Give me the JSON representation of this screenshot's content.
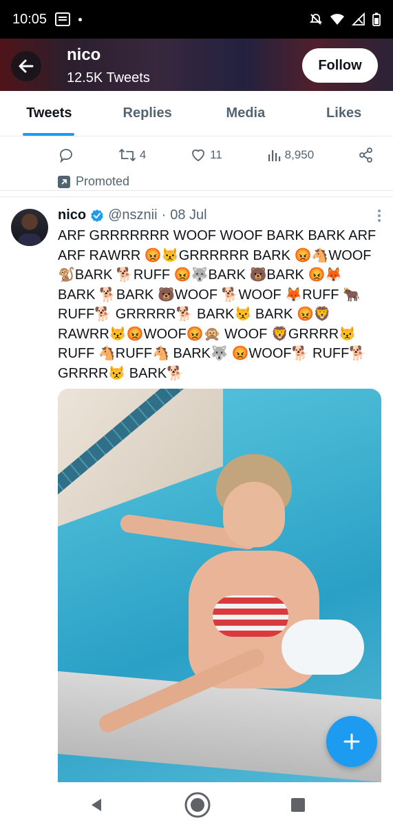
{
  "status_bar": {
    "time": "10:05"
  },
  "header": {
    "name": "nico",
    "tweet_count": "12.5K Tweets",
    "follow_label": "Follow"
  },
  "tabs": [
    {
      "label": "Tweets",
      "active": true
    },
    {
      "label": "Replies",
      "active": false
    },
    {
      "label": "Media",
      "active": false
    },
    {
      "label": "Likes",
      "active": false
    }
  ],
  "promoted_tweet": {
    "retweets": "4",
    "likes": "11",
    "views": "8,950",
    "promoted_label": "Promoted"
  },
  "tweet": {
    "name": "nico",
    "handle": "@nsznii",
    "separator": "·",
    "date": "08 Jul",
    "text": "ARF GRRRRRRR WOOF WOOF BARK BARK ARF ARF RAWRR 😡😾GRRRRRR BARK 😡🐴WOOF 🐒BARK 🐕RUFF 😡🐺BARK 🐻BARK 😡🦊 BARK 🐕BARK 🐻WOOF 🐕WOOF 🦊RUFF 🐂 RUFF🐕 GRRRRR🐕 BARK😾 BARK 😡🦁 RAWRR😾😡WOOF😡🙊 WOOF 🦁GRRRR😾 RUFF 🐴RUFF🐴 BARK🐺 😡WOOF🐕 RUFF🐕 GRRRR😾 BARK🐕"
  },
  "colors": {
    "accent": "#1d9bf0",
    "text_primary": "#0f1419",
    "text_secondary": "#536471",
    "status_bar_bg": "#000000"
  }
}
